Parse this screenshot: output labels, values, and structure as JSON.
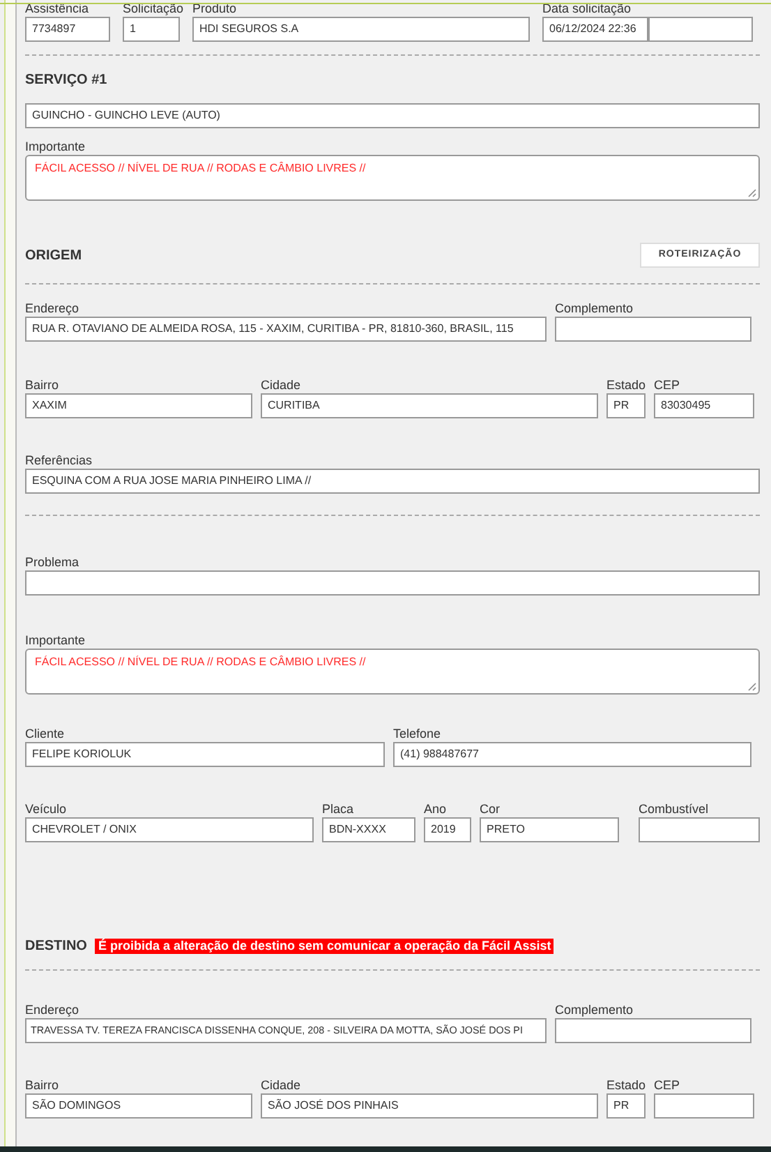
{
  "header": {
    "fields": [
      {
        "label": "Assistência",
        "value": "7734897"
      },
      {
        "label": "Solicitação",
        "value": "1"
      },
      {
        "label": "Produto",
        "value": "HDI SEGUROS S.A"
      },
      {
        "label": "Data solicitação",
        "value": "06/12/2024 22:36"
      }
    ]
  },
  "service": {
    "title": "SERVIÇO #1",
    "type": "GUINCHO - GUINCHO LEVE (AUTO)",
    "important": {
      "label": "Importante",
      "value": "FÁCIL ACESSO // NÍVEL DE RUA // RODAS E CÂMBIO LIVRES //"
    }
  },
  "origin": {
    "title": "ORIGEM",
    "button": "ROTEIRIZAÇÃO",
    "address": {
      "label": "Endereço",
      "value": "RUA R. OTAVIANO DE ALMEIDA ROSA, 115 - XAXIM, CURITIBA - PR, 81810-360, BRASIL, 115"
    },
    "complement": {
      "label": "Complemento"
    },
    "district": {
      "label": "Bairro",
      "value": "XAXIM"
    },
    "city": {
      "label": "Cidade",
      "value": "CURITIBA"
    },
    "state": {
      "label": "Estado",
      "value": "PR"
    },
    "zip": {
      "label": "CEP",
      "value": "83030495"
    },
    "references": {
      "label": "Referências",
      "value": "ESQUINA COM A RUA JOSE MARIA PINHEIRO LIMA //"
    }
  },
  "details": {
    "problem": {
      "label": "Problema"
    },
    "important": {
      "label": "Importante",
      "value": "FÁCIL ACESSO // NÍVEL DE RUA // RODAS E CÂMBIO LIVRES //"
    },
    "client": {
      "label": "Cliente",
      "value": "FELIPE KORIOLUK"
    },
    "phone": {
      "label": "Telefone",
      "value": "(41) 988487677"
    },
    "vehicle": {
      "label": "Veículo",
      "value": "CHEVROLET / ONIX"
    },
    "plate": {
      "label": "Placa",
      "value": "BDN-XXXX"
    },
    "year": {
      "label": "Ano",
      "value": "2019"
    },
    "color": {
      "label": "Cor",
      "value": "PRETO"
    },
    "fuel": {
      "label": "Combustível"
    }
  },
  "destination": {
    "title": "DESTINO",
    "warning": "É proibida a alteração de destino sem comunicar a operação da Fácil Assist",
    "address": {
      "label": "Endereço",
      "value": "TRAVESSA TV. TEREZA FRANCISCA DISSENHA CONQUE, 208 - SILVEIRA DA MOTTA, SÃO JOSÉ DOS PI"
    },
    "complement": {
      "label": "Complemento"
    },
    "district": {
      "label": "Bairro",
      "value": "SÃO DOMINGOS"
    },
    "city": {
      "label": "Cidade",
      "value": "SÃO JOSÉ DOS PINHAIS"
    },
    "state": {
      "label": "Estado",
      "value": "PR"
    },
    "zip": {
      "label": "CEP"
    }
  }
}
